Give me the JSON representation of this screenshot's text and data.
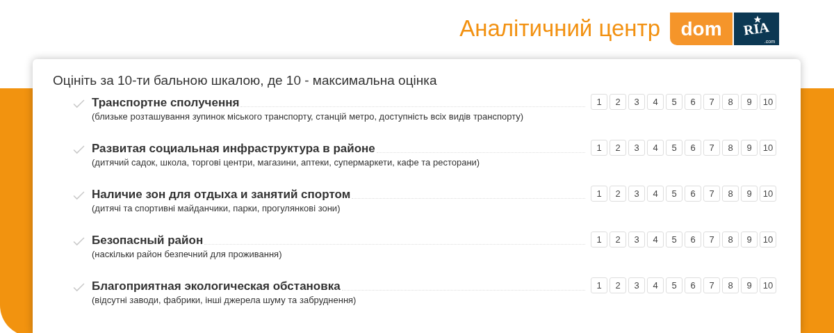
{
  "header": {
    "title": "Аналітичний центр",
    "logo": {
      "left": "dom",
      "right": "RIA",
      "suffix": ".com"
    }
  },
  "survey": {
    "prompt": "Оцініть за 10-ти бальною шкалою, де 10 - максимальна оцінка",
    "criteria": [
      {
        "title": "Транспортне сполучення",
        "note": "(близьке розташування зупинок міського транспорту, станцій метро, доступність всіх видів транспорту)",
        "scores": [
          {
            "label": "1",
            "selected": false
          },
          {
            "label": "2",
            "selected": false
          },
          {
            "label": "3",
            "selected": false
          },
          {
            "label": "4",
            "selected": false
          },
          {
            "label": "5",
            "selected": false
          },
          {
            "label": "6",
            "selected": false
          },
          {
            "label": "7",
            "selected": false
          },
          {
            "label": "8",
            "selected": false
          },
          {
            "label": "9",
            "selected": false
          },
          {
            "label": "10",
            "selected": false
          }
        ]
      },
      {
        "title": "Развитая социальная инфраструктура в районе",
        "note": "(дитячий садок, школа, торгові центри, магазини, аптеки, супермаркети, кафе та ресторани)",
        "scores": [
          {
            "label": "1",
            "selected": false
          },
          {
            "label": "2",
            "selected": false
          },
          {
            "label": "3",
            "selected": false
          },
          {
            "label": "4",
            "selected": false
          },
          {
            "label": "5",
            "selected": false
          },
          {
            "label": "6",
            "selected": false
          },
          {
            "label": "7",
            "selected": false
          },
          {
            "label": "8",
            "selected": false
          },
          {
            "label": "9",
            "selected": false
          },
          {
            "label": "10",
            "selected": false
          }
        ]
      },
      {
        "title": "Наличие зон для отдыха и занятий спортом",
        "note": "(дитячі та спортивні майданчики, парки, прогулянкові зони)",
        "scores": [
          {
            "label": "1",
            "selected": false
          },
          {
            "label": "2",
            "selected": false
          },
          {
            "label": "3",
            "selected": false
          },
          {
            "label": "4",
            "selected": false
          },
          {
            "label": "5",
            "selected": false
          },
          {
            "label": "6",
            "selected": false
          },
          {
            "label": "7",
            "selected": false
          },
          {
            "label": "8",
            "selected": false
          },
          {
            "label": "9",
            "selected": false
          },
          {
            "label": "10",
            "selected": false
          }
        ]
      },
      {
        "title": "Безопасный район",
        "note": "(наскільки район безпечний для проживання)",
        "scores": [
          {
            "label": "1",
            "selected": false
          },
          {
            "label": "2",
            "selected": false
          },
          {
            "label": "3",
            "selected": false
          },
          {
            "label": "4",
            "selected": false
          },
          {
            "label": "5",
            "selected": false
          },
          {
            "label": "6",
            "selected": false
          },
          {
            "label": "7",
            "selected": false
          },
          {
            "label": "8",
            "selected": false
          },
          {
            "label": "9",
            "selected": false
          },
          {
            "label": "10",
            "selected": false
          }
        ]
      },
      {
        "title": "Благоприятная экологическая обстановка",
        "note": "(відсутні заводи, фабрики, інші джерела шуму та забруднення)",
        "scores": [
          {
            "label": "1",
            "selected": false
          },
          {
            "label": "2",
            "selected": false
          },
          {
            "label": "3",
            "selected": false
          },
          {
            "label": "4",
            "selected": false
          },
          {
            "label": "5",
            "selected": false
          },
          {
            "label": "6",
            "selected": false
          },
          {
            "label": "7",
            "selected": false
          },
          {
            "label": "8",
            "selected": false
          },
          {
            "label": "9",
            "selected": false
          },
          {
            "label": "10",
            "selected": false
          }
        ]
      }
    ]
  }
}
